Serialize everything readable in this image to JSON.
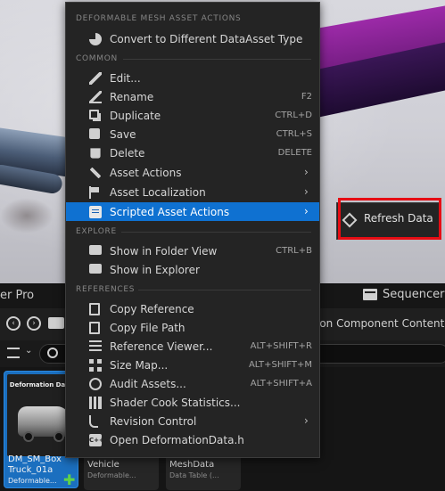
{
  "menu": {
    "sections": [
      {
        "label": "DEFORMABLE MESH ASSET ACTIONS"
      },
      {
        "label": "COMMON"
      },
      {
        "label": "EXPLORE"
      },
      {
        "label": "REFERENCES"
      }
    ],
    "items": [
      {
        "label": "Convert to Different DataAsset Type",
        "shortcut": "",
        "icon": "pie-chart-icon"
      },
      {
        "label": "Edit...",
        "shortcut": "",
        "icon": "pencil-icon"
      },
      {
        "label": "Rename",
        "shortcut": "F2",
        "icon": "rename-icon"
      },
      {
        "label": "Duplicate",
        "shortcut": "CTRL+D",
        "icon": "duplicate-icon"
      },
      {
        "label": "Save",
        "shortcut": "CTRL+S",
        "icon": "save-icon"
      },
      {
        "label": "Delete",
        "shortcut": "DELETE",
        "icon": "trash-icon"
      },
      {
        "label": "Asset Actions",
        "shortcut": "",
        "icon": "wrench-icon",
        "submenu": true
      },
      {
        "label": "Asset Localization",
        "shortcut": "",
        "icon": "flag-icon",
        "submenu": true
      },
      {
        "label": "Scripted Asset Actions",
        "shortcut": "",
        "icon": "script-icon",
        "submenu": true,
        "highlighted": true
      },
      {
        "label": "Show in Folder View",
        "shortcut": "CTRL+B",
        "icon": "folder-search-icon"
      },
      {
        "label": "Show in Explorer",
        "shortcut": "",
        "icon": "folder-search-icon"
      },
      {
        "label": "Copy Reference",
        "shortcut": "",
        "icon": "copy-icon"
      },
      {
        "label": "Copy File Path",
        "shortcut": "",
        "icon": "copy-icon"
      },
      {
        "label": "Reference Viewer...",
        "shortcut": "ALT+SHIFT+R",
        "icon": "reference-viewer-icon"
      },
      {
        "label": "Size Map...",
        "shortcut": "ALT+SHIFT+M",
        "icon": "size-map-icon"
      },
      {
        "label": "Audit Assets...",
        "shortcut": "ALT+SHIFT+A",
        "icon": "audit-icon"
      },
      {
        "label": "Shader Cook Statistics...",
        "shortcut": "",
        "icon": "shader-stats-icon"
      },
      {
        "label": "Revision Control",
        "shortcut": "",
        "icon": "revision-control-icon",
        "submenu": true
      },
      {
        "label": "Open DeformationData.h",
        "shortcut": "",
        "icon": "cpp-file-icon"
      }
    ],
    "arrow_glyph": "›"
  },
  "submenu": {
    "label": "Refresh Data",
    "icon": "refresh-data-icon"
  },
  "panels": {
    "left_tab": "er Pro",
    "sequencer_tab": "Sequencer",
    "path_text": "ion Component Content"
  },
  "assets": [
    {
      "thumb_title": "Deformation Data",
      "name_line1": "DM_SM_Box",
      "name_line2": "Truck_01a",
      "type": "Deformable...",
      "selected": true
    },
    {
      "name": "Vehicle",
      "type": "Deformable..."
    },
    {
      "name": "MeshData",
      "type": "Data Table (..."
    }
  ],
  "colors": {
    "menu_bg": "#242424",
    "highlight": "#0f71d1",
    "annotation_box": "#e60d14",
    "selected_tile": "#1b6fbf"
  }
}
